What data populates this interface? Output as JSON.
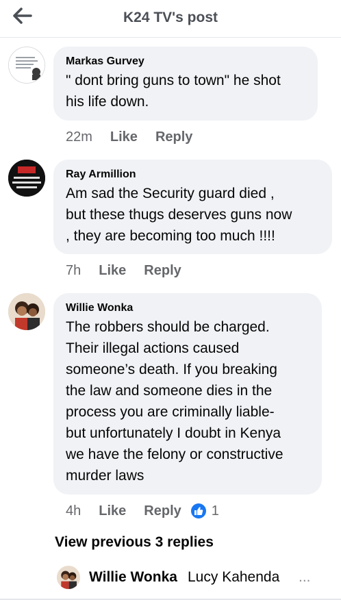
{
  "header": {
    "title": "K24 TV's post"
  },
  "comments": [
    {
      "author": "Markas Gurvey",
      "lines": [
        "\" dont bring guns to town\" he shot",
        "his life down."
      ],
      "time": "22m",
      "like_label": "Like",
      "reply_label": "Reply"
    },
    {
      "author": "Ray Armillion",
      "lines": [
        "Am sad the Security guard died ,",
        "but these thugs deserves guns now",
        ", they are becoming too much !!!!"
      ],
      "time": "7h",
      "like_label": "Like",
      "reply_label": "Reply"
    },
    {
      "author": "Willie Wonka",
      "lines": [
        "The robbers should be charged.",
        "Their illegal actions caused",
        "someone’s death.  If you breaking",
        "the law and someone dies in the",
        "process you are criminally liable-",
        "but unfortunately I doubt in Kenya",
        "we have the felony or constructive",
        "murder laws"
      ],
      "time": "4h",
      "like_label": "Like",
      "reply_label": "Reply",
      "reaction_count": "1",
      "reaction_icon": "thumbs-up-icon"
    }
  ],
  "view_previous": "View previous 3 replies",
  "reply_preview": {
    "author": "Willie Wonka",
    "text": "Lucy Kahenda",
    "ellipsis": "..."
  },
  "colors": {
    "bubble": "#f0f2f5",
    "meta_text": "#65676b",
    "like_blue": "#1877f2",
    "header_text": "#4b4f56"
  }
}
